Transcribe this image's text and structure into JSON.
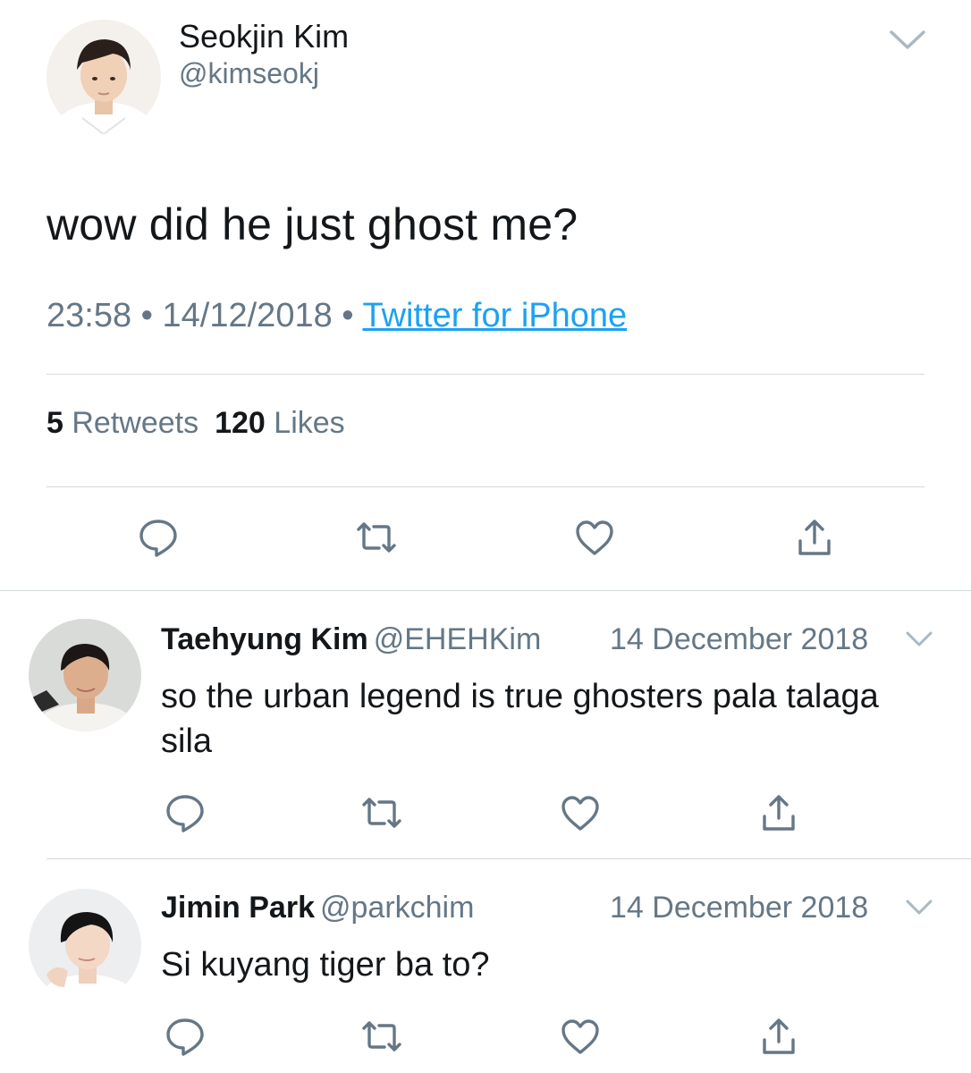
{
  "main_tweet": {
    "author_name": "Seokjin Kim",
    "author_handle": "@kimseokj",
    "text": "wow did he just ghost me?",
    "time": "23:58",
    "separator": "•",
    "date": "14/12/2018",
    "source": "Twitter for iPhone",
    "retweet_count": "5",
    "retweet_label": "Retweets",
    "like_count": "120",
    "like_label": "Likes"
  },
  "replies": [
    {
      "author_name": "Taehyung Kim",
      "author_handle": "@EHEHKim",
      "date": "14 December 2018",
      "text": "so the urban legend is true ghosters pala talaga sila"
    },
    {
      "author_name": "Jimin Park",
      "author_handle": "@parkchim",
      "date": "14 December 2018",
      "text": "Si kuyang tiger ba to?"
    }
  ],
  "icons": {
    "reply": "reply-icon",
    "retweet": "retweet-icon",
    "like": "heart-icon",
    "share": "share-icon",
    "more": "chevron-down-icon"
  },
  "colors": {
    "text": "#14171a",
    "secondary": "#657786",
    "link": "#1da1f2",
    "divider": "#d4d9dd"
  }
}
